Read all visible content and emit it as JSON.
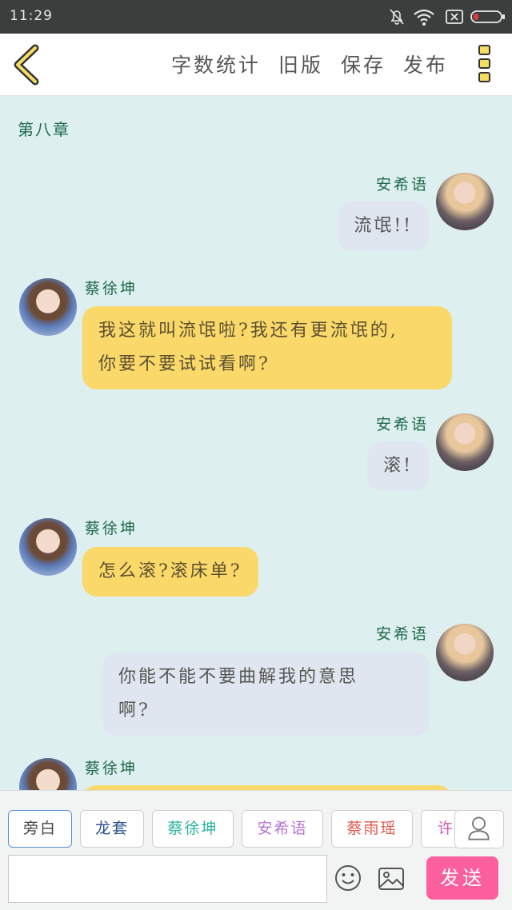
{
  "status_bar": {
    "time": "11:29"
  },
  "header": {
    "actions": [
      "字数统计",
      "旧版",
      "保存",
      "发布"
    ]
  },
  "chapter_title": "第八章",
  "messages": [
    {
      "speaker": "安希语",
      "text": "流氓!!"
    },
    {
      "speaker": "蔡徐坤",
      "text_lines": [
        "我这就叫流氓啦?我还有更流氓的,",
        "你要不要试试看啊?"
      ]
    },
    {
      "speaker": "安希语",
      "text": "滚!"
    },
    {
      "speaker": "蔡徐坤",
      "text": "怎么滚?滚床单?"
    },
    {
      "speaker": "安希语",
      "text_lines": [
        "你能不能不要曲解我的意思",
        "啊?"
      ]
    },
    {
      "speaker": "蔡徐坤"
    }
  ],
  "roles": [
    {
      "label": "旁白",
      "color": "#444444"
    },
    {
      "label": "龙套",
      "color": "#2a4d8f"
    },
    {
      "label": "蔡徐坤",
      "color": "#2bb39b"
    },
    {
      "label": "安希语",
      "color": "#b377d6"
    },
    {
      "label": "蔡雨瑶",
      "color": "#e0574a"
    },
    {
      "label": "许",
      "color": "#d659a8"
    }
  ],
  "input": {
    "placeholder": ""
  },
  "send_label": "发送"
}
